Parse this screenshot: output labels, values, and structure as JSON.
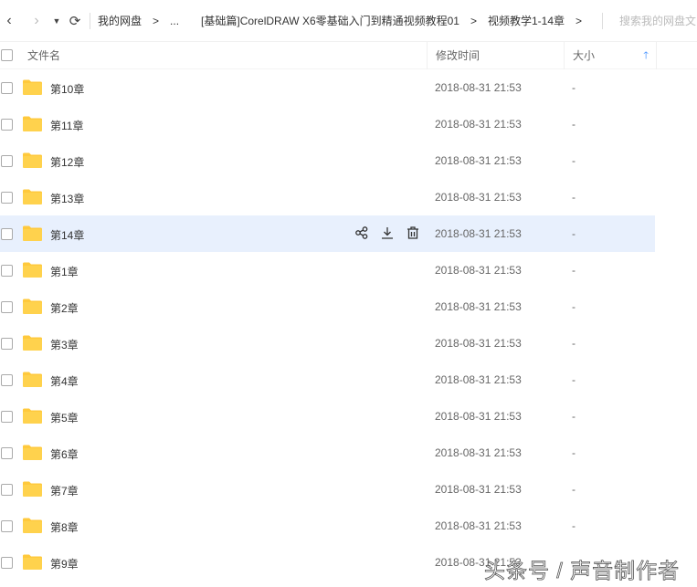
{
  "toolbar": {
    "breadcrumb": [
      "我的网盘",
      "...",
      "[基础篇]CorelDRAW X6零基础入门到精通视频教程01",
      "视频教学1-14章"
    ],
    "separator": ">",
    "search_placeholder": "搜索我的网盘文"
  },
  "header": {
    "name": "文件名",
    "time": "修改时间",
    "size": "大小"
  },
  "rows": [
    {
      "name": "第10章",
      "time": "2018-08-31 21:53",
      "size": "-"
    },
    {
      "name": "第11章",
      "time": "2018-08-31 21:53",
      "size": "-"
    },
    {
      "name": "第12章",
      "time": "2018-08-31 21:53",
      "size": "-"
    },
    {
      "name": "第13章",
      "time": "2018-08-31 21:53",
      "size": "-"
    },
    {
      "name": "第14章",
      "time": "2018-08-31 21:53",
      "size": "-"
    },
    {
      "name": "第1章",
      "time": "2018-08-31 21:53",
      "size": "-"
    },
    {
      "name": "第2章",
      "time": "2018-08-31 21:53",
      "size": "-"
    },
    {
      "name": "第3章",
      "time": "2018-08-31 21:53",
      "size": "-"
    },
    {
      "name": "第4章",
      "time": "2018-08-31 21:53",
      "size": "-"
    },
    {
      "name": "第5章",
      "time": "2018-08-31 21:53",
      "size": "-"
    },
    {
      "name": "第6章",
      "time": "2018-08-31 21:53",
      "size": "-"
    },
    {
      "name": "第7章",
      "time": "2018-08-31 21:53",
      "size": "-"
    },
    {
      "name": "第8章",
      "time": "2018-08-31 21:53",
      "size": "-"
    },
    {
      "name": "第9章",
      "time": "2018-08-31 21:53",
      "size": "-"
    }
  ],
  "hover_row": 4,
  "watermark": "头条号 / 声音制作者",
  "colors": {
    "folder": "#ffc93c",
    "hover": "#e8f0fd",
    "accent": "#3b8cff"
  }
}
